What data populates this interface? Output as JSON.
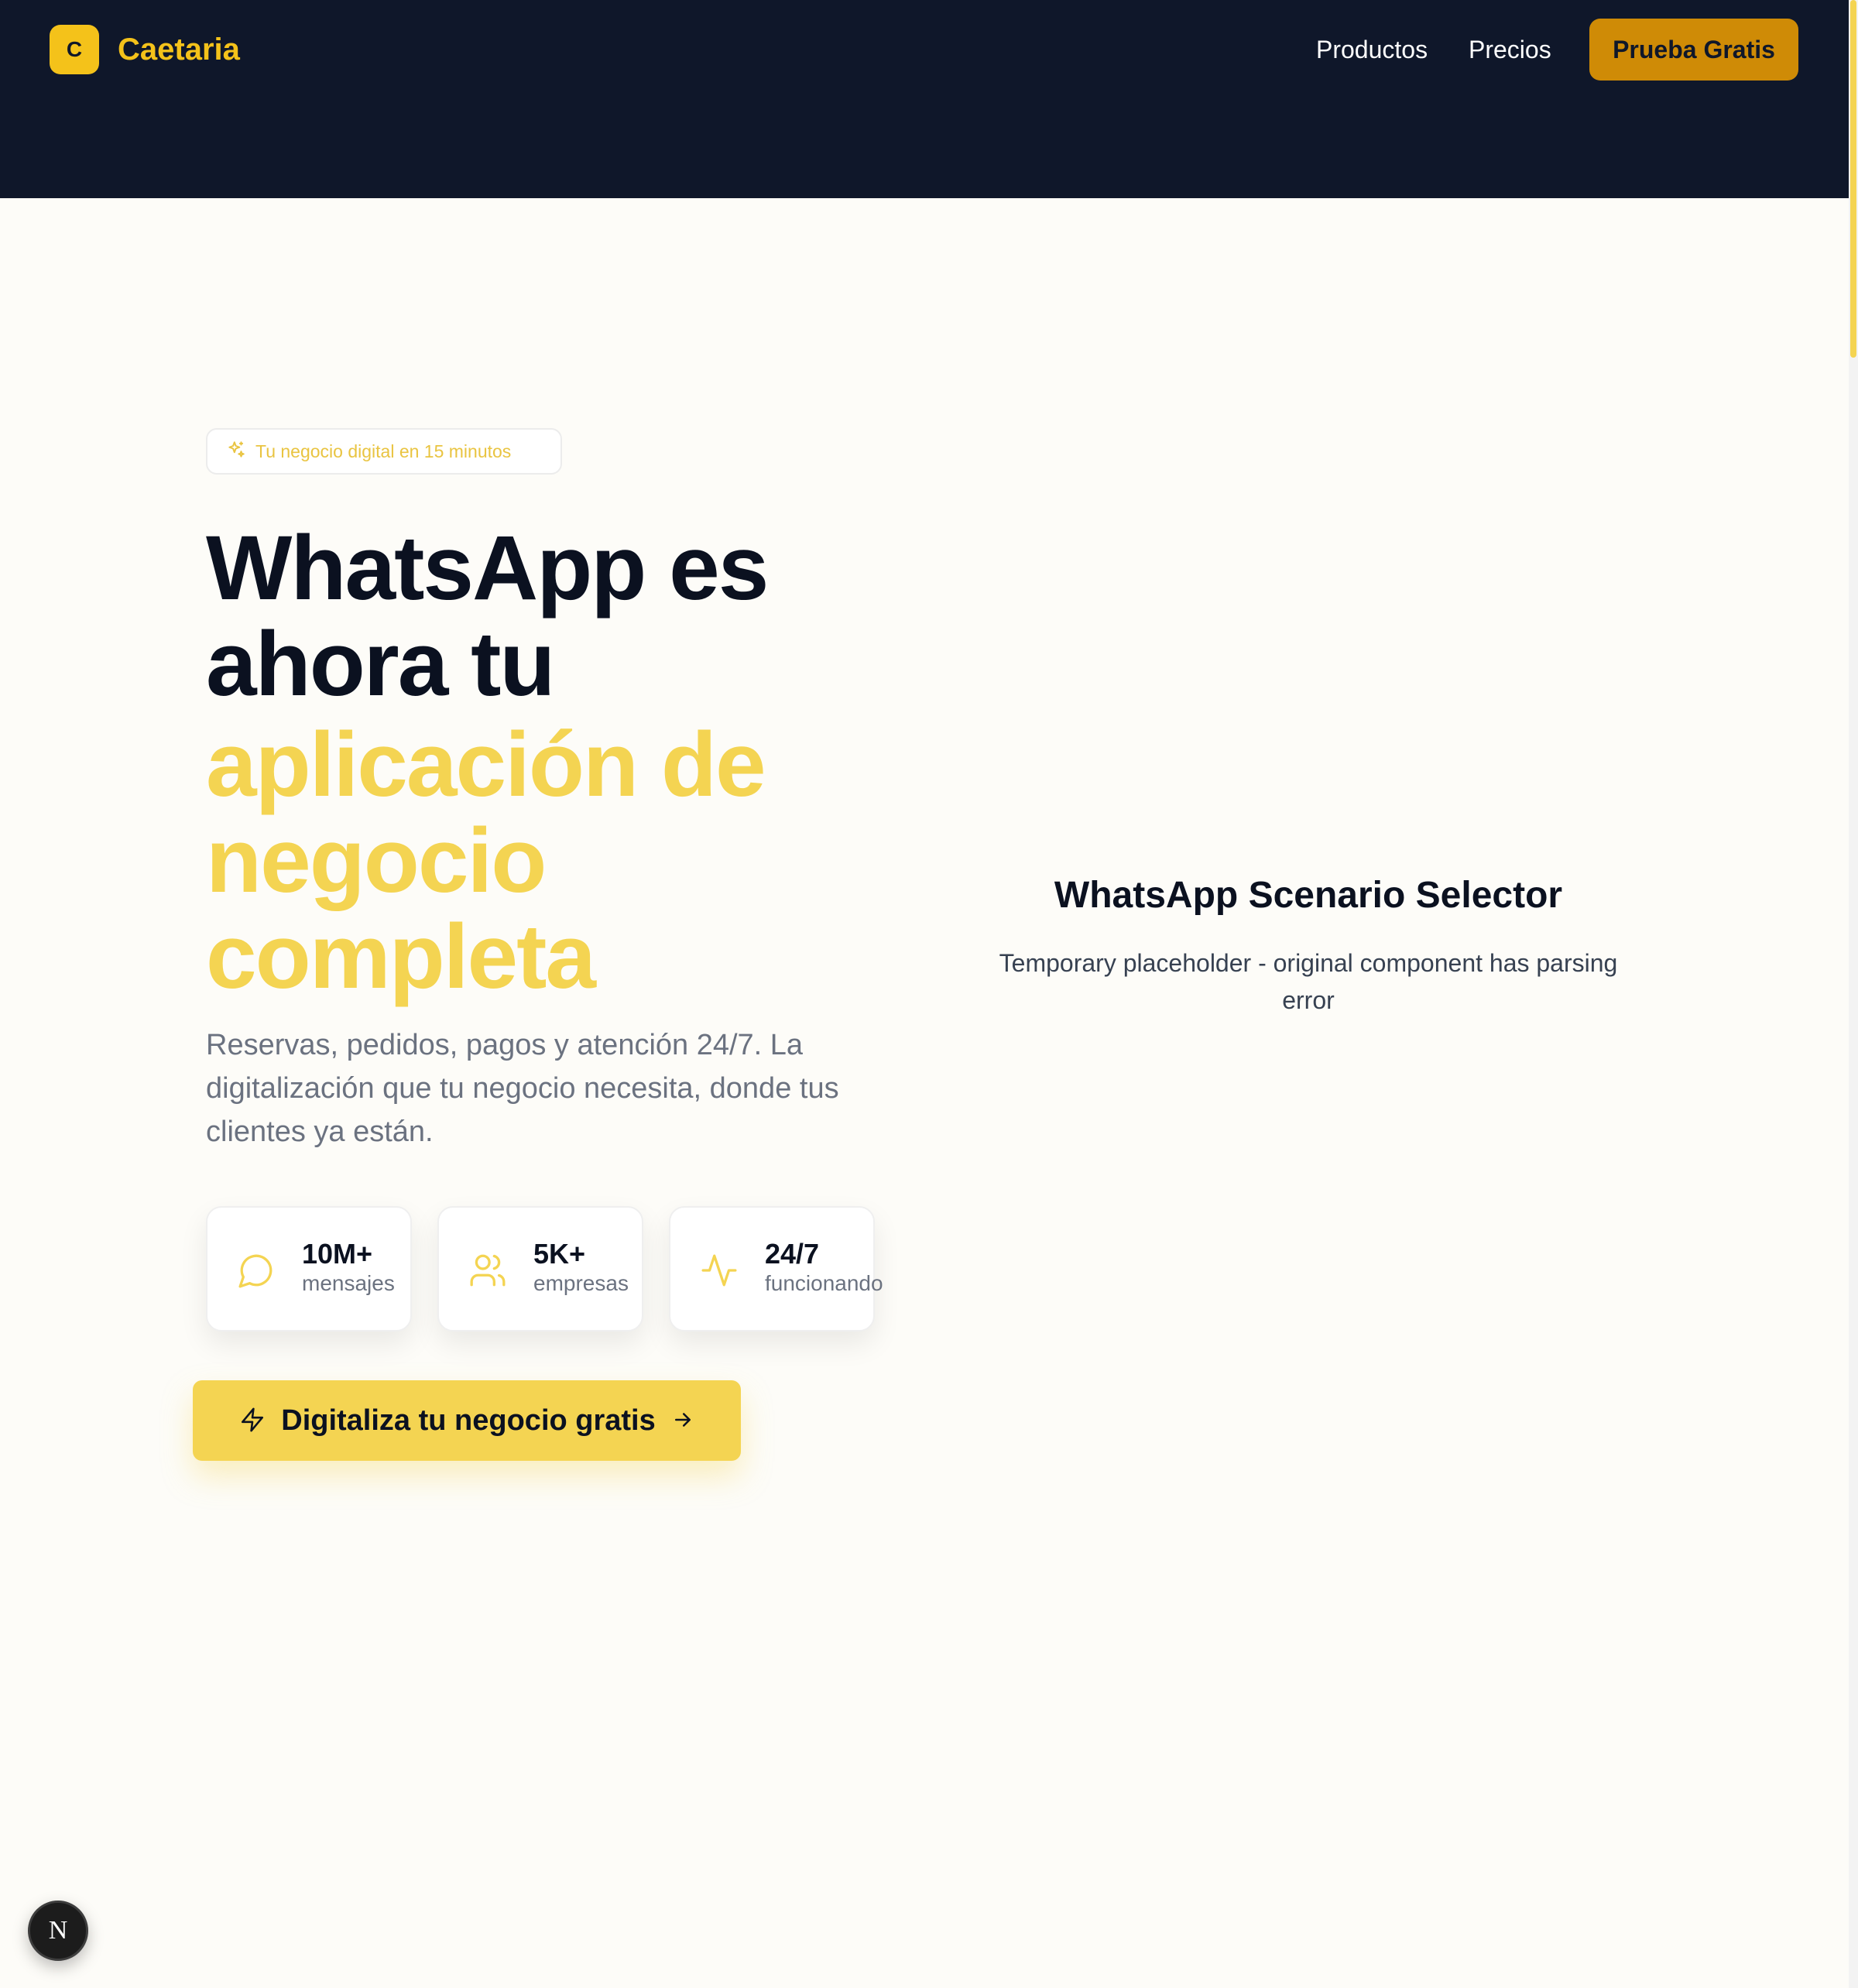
{
  "header": {
    "logo_letter": "C",
    "brand": "Caetaria",
    "nav": [
      {
        "label": "Productos"
      },
      {
        "label": "Precios"
      }
    ],
    "cta_label": "Prueba Gratis"
  },
  "hero": {
    "badge_text": "Tu negocio digital en 15 minutos",
    "badge_icon": "sparkles-icon",
    "headline_dark": [
      "WhatsApp es",
      "ahora tu"
    ],
    "headline_accent": [
      "aplicación de",
      "negocio",
      "completa"
    ],
    "description": "Reservas, pedidos, pagos y atención 24/7. La digitalización que tu negocio necesita, donde tus clientes ya están.",
    "stats": [
      {
        "icon": "message-circle-icon",
        "value": "10M+",
        "label": "mensajes"
      },
      {
        "icon": "users-icon",
        "value": "5K+",
        "label": "empresas"
      },
      {
        "icon": "activity-icon",
        "value": "24/7",
        "label": "funcionando"
      }
    ],
    "cta_label": "Digitaliza tu negocio gratis",
    "cta_icon_left": "zap-icon",
    "cta_icon_right": "arrow-right-icon"
  },
  "placeholder": {
    "title": "WhatsApp Scenario Selector",
    "description": "Temporary placeholder - original component has parsing error"
  },
  "next_badge": {
    "letter": "N"
  },
  "colors": {
    "header_bg": "#0f172a",
    "brand_yellow": "#f4c21a",
    "accent_yellow": "#f4d452",
    "cta_top_bg": "#cf8b06",
    "page_bg": "#fdfcf8"
  }
}
